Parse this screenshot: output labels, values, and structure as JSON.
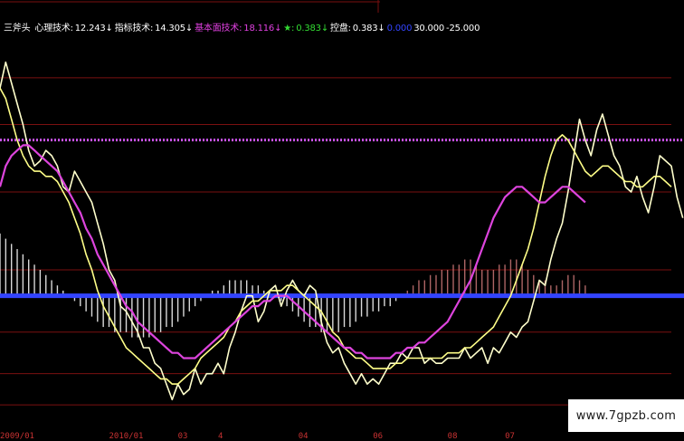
{
  "legend": {
    "indicator_name": "三斧头",
    "items": [
      {
        "label": "心理技术:",
        "value": "12.243",
        "arrow": "↓",
        "label_color": "#ffffff",
        "value_color": "#ffffff"
      },
      {
        "label": "指标技术:",
        "value": "14.305",
        "arrow": "↓",
        "label_color": "#ffffff",
        "value_color": "#ffffff"
      },
      {
        "label": "基本面技术:",
        "value": "18.116",
        "arrow": "↓",
        "label_color": "#e040e0",
        "value_color": "#e040e0"
      },
      {
        "label": "★:",
        "value": "0.383",
        "arrow": "↓",
        "label_color": "#33dd33",
        "value_color": "#33dd33"
      },
      {
        "label": "控盘:",
        "value": "0.383",
        "arrow": "↓",
        "label_color": "#ffffff",
        "value_color": "#ffffff"
      },
      {
        "label": "",
        "value": "0.000",
        "arrow": "",
        "label_color": "#3344ff",
        "value_color": "#3344ff"
      },
      {
        "label": "",
        "value": "30.000",
        "arrow": "",
        "label_color": "#ffffff",
        "value_color": "#ffffff"
      },
      {
        "label": "",
        "value": "-25.000",
        "arrow": "",
        "label_color": "#ffffff",
        "value_color": "#ffffff"
      }
    ]
  },
  "watermark": "www.7gpzb.com",
  "colors": {
    "background": "#000000",
    "grid": "#7a1010",
    "psych": "#ffffcc",
    "indicator": "#ffff88",
    "fundamental": "#dd44dd",
    "zero_line": "#3344ff",
    "histogram": "#ffffff",
    "hist_red": "#cc7777",
    "thirty_line": "#cc55ee",
    "axis_labels": "#c83232"
  },
  "chart_data": {
    "type": "line",
    "x_tick_labels": [
      "2009/01",
      "2010/01",
      "03",
      "4",
      "04",
      "06",
      "08",
      "07"
    ],
    "x_tick_positions": [
      0,
      19,
      31,
      38,
      52,
      65,
      78,
      88
    ],
    "x_count": 118,
    "ylim": [
      -25,
      50
    ],
    "reference_lines": [
      {
        "name": "30.000",
        "value": 30,
        "style": "dotted",
        "color": "#cc55ee"
      },
      {
        "name": "0.000",
        "value": 0,
        "style": "solid",
        "color": "#3344ff"
      }
    ],
    "grid_levels": [
      42,
      33,
      20,
      5,
      -7,
      -15,
      -21
    ],
    "series": [
      {
        "name": "心理技术",
        "color": "#ffffcc",
        "values": [
          40,
          45,
          41,
          37,
          33,
          28,
          25,
          26,
          28,
          27,
          25,
          21,
          20,
          24,
          22,
          20,
          18,
          14,
          10,
          5,
          3,
          -2,
          -3,
          -5,
          -7,
          -10,
          -10,
          -13,
          -14,
          -17,
          -20,
          -17,
          -19,
          -18,
          -14,
          -17,
          -15,
          -15,
          -13,
          -15,
          -10,
          -7,
          -3,
          0,
          0,
          -5,
          -3,
          1,
          2,
          -2,
          1,
          3,
          1,
          0,
          2,
          1,
          -5,
          -9,
          -11,
          -10,
          -13,
          -15,
          -17,
          -15,
          -17,
          -16,
          -17,
          -15,
          -13,
          -13,
          -11,
          -12,
          -10,
          -10,
          -13,
          -12,
          -13,
          -13,
          -12,
          -12,
          -12,
          -10,
          -12,
          -11,
          -10,
          -13,
          -10,
          -11,
          -9,
          -7,
          -8,
          -6,
          -5,
          -1,
          3,
          2,
          7,
          11,
          14,
          20,
          27,
          34,
          30,
          27,
          32,
          35,
          31,
          27,
          25,
          21,
          20,
          23,
          19,
          16,
          21,
          27,
          26,
          25,
          19,
          15
        ]
      },
      {
        "name": "指标技术",
        "color": "#ffff88",
        "values": [
          40,
          38,
          34,
          30,
          27,
          25,
          24,
          24,
          23,
          23,
          22,
          20,
          18,
          15,
          12,
          8,
          5,
          1,
          -2,
          -4,
          -6,
          -8,
          -10,
          -11,
          -12,
          -13,
          -14,
          -15,
          -16,
          -16,
          -17,
          -17,
          -16,
          -15,
          -14,
          -12,
          -11,
          -10,
          -9,
          -8,
          -6,
          -5,
          -3,
          -2,
          -1,
          -1,
          0,
          1,
          1,
          1,
          2,
          2,
          1,
          0,
          -1,
          -2,
          -3,
          -5,
          -7,
          -8,
          -10,
          -11,
          -12,
          -12,
          -13,
          -14,
          -14,
          -14,
          -14,
          -13,
          -13,
          -12,
          -12,
          -12,
          -12,
          -12,
          -12,
          -12,
          -11,
          -11,
          -11,
          -10,
          -10,
          -9,
          -8,
          -7,
          -6,
          -4,
          -2,
          0,
          3,
          6,
          9,
          13,
          18,
          23,
          27,
          30,
          31,
          30,
          28,
          26,
          24,
          23,
          24,
          25,
          25,
          24,
          23,
          22,
          22,
          21,
          21,
          22,
          23,
          23,
          22,
          21
        ]
      },
      {
        "name": "基本面技术",
        "color": "#dd44dd",
        "values": [
          21,
          25,
          27,
          28,
          29,
          29,
          28,
          27,
          26,
          25,
          24,
          22,
          20,
          18,
          16,
          13,
          11,
          8,
          6,
          4,
          2,
          0,
          -2,
          -3,
          -5,
          -6,
          -7,
          -8,
          -9,
          -10,
          -11,
          -11,
          -12,
          -12,
          -12,
          -11,
          -10,
          -9,
          -8,
          -7,
          -6,
          -5,
          -4,
          -3,
          -2,
          -2,
          -1,
          -1,
          0,
          0,
          0,
          -1,
          -2,
          -3,
          -4,
          -5,
          -6,
          -7,
          -8,
          -9,
          -10,
          -10,
          -11,
          -11,
          -12,
          -12,
          -12,
          -12,
          -12,
          -11,
          -11,
          -10,
          -10,
          -9,
          -9,
          -8,
          -7,
          -6,
          -5,
          -3,
          -1,
          1,
          3,
          6,
          9,
          12,
          15,
          17,
          19,
          20,
          21,
          21,
          20,
          19,
          18,
          18,
          19,
          20,
          21,
          21,
          20,
          19,
          18
        ]
      }
    ],
    "histogram": [
      12,
      11,
      10,
      9,
      8,
      7,
      6,
      5,
      4,
      3,
      2,
      1,
      0,
      -1,
      -2,
      -3,
      -4,
      -5,
      -6,
      -6,
      -7,
      -7,
      -7,
      -8,
      -8,
      -8,
      -8,
      -7,
      -7,
      -6,
      -6,
      -5,
      -4,
      -3,
      -2,
      -1,
      0,
      1,
      1,
      2,
      3,
      3,
      3,
      3,
      2,
      2,
      1,
      1,
      0,
      -1,
      -2,
      -3,
      -4,
      -5,
      -6,
      -6,
      -7,
      -7,
      -7,
      -7,
      -6,
      -6,
      -5,
      -4,
      -4,
      -3,
      -3,
      -2,
      -2,
      -1,
      0,
      1,
      2,
      3,
      3,
      4,
      4,
      5,
      5,
      6,
      6,
      7,
      7,
      6,
      5,
      5,
      5,
      6,
      6,
      7,
      7,
      6,
      5,
      4,
      3,
      3,
      2,
      2,
      3,
      4,
      4,
      3,
      2
    ]
  }
}
